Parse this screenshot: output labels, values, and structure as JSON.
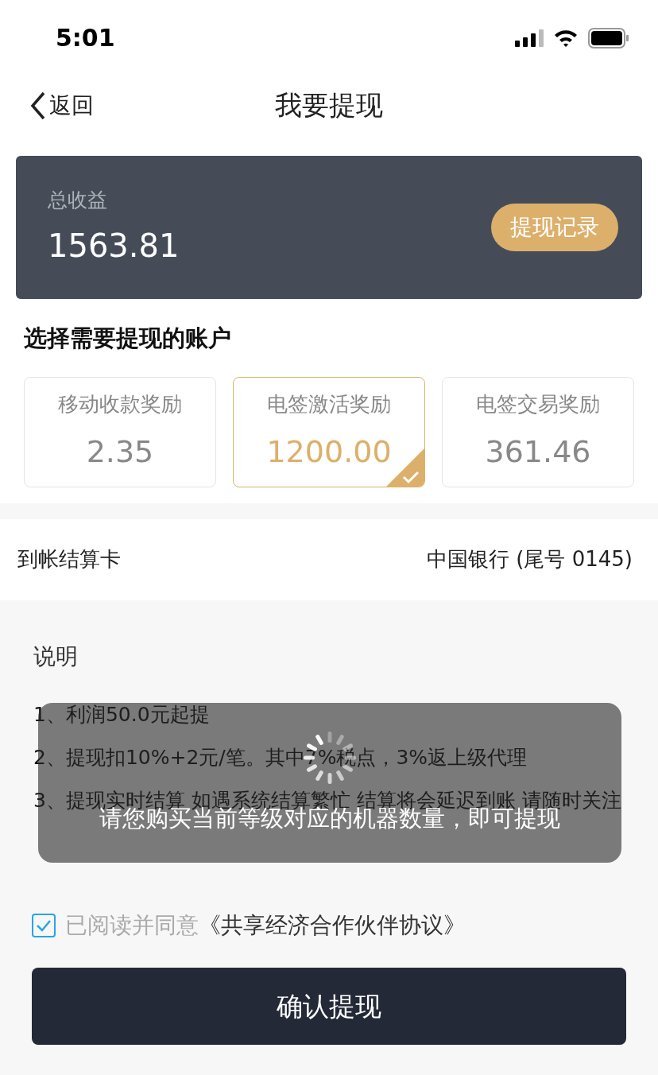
{
  "status_bar": {
    "time": "5:01"
  },
  "nav": {
    "back": "返回",
    "title": "我要提现"
  },
  "earnings": {
    "label": "总收益",
    "amount": "1563.81",
    "history_button": "提现记录"
  },
  "accounts_title": "选择需要提现的账户",
  "accounts": [
    {
      "name": "移动收款奖励",
      "amount": "2.35",
      "selected": false
    },
    {
      "name": "电签激活奖励",
      "amount": "1200.00",
      "selected": true
    },
    {
      "name": "电签交易奖励",
      "amount": "361.46",
      "selected": false
    }
  ],
  "settlement": {
    "label": "到帐结算卡",
    "value": "中国银行 (尾号 0145)"
  },
  "notes": {
    "title": "说明",
    "items": [
      "1、利润50.0元起提",
      "2、提现扣10%+2元/笔。其中7%税点，3%返上级代理",
      "3、提现实时结算 如遇系统结算繁忙 结算将会延迟到账 请随时关注"
    ]
  },
  "agreement": {
    "checked": true,
    "prefix": "已阅读并同意",
    "link": "《共享经济合作伙伴协议》"
  },
  "confirm_button": "确认提现",
  "toast": {
    "message": "请您购买当前等级对应的机器数量，即可提现"
  }
}
